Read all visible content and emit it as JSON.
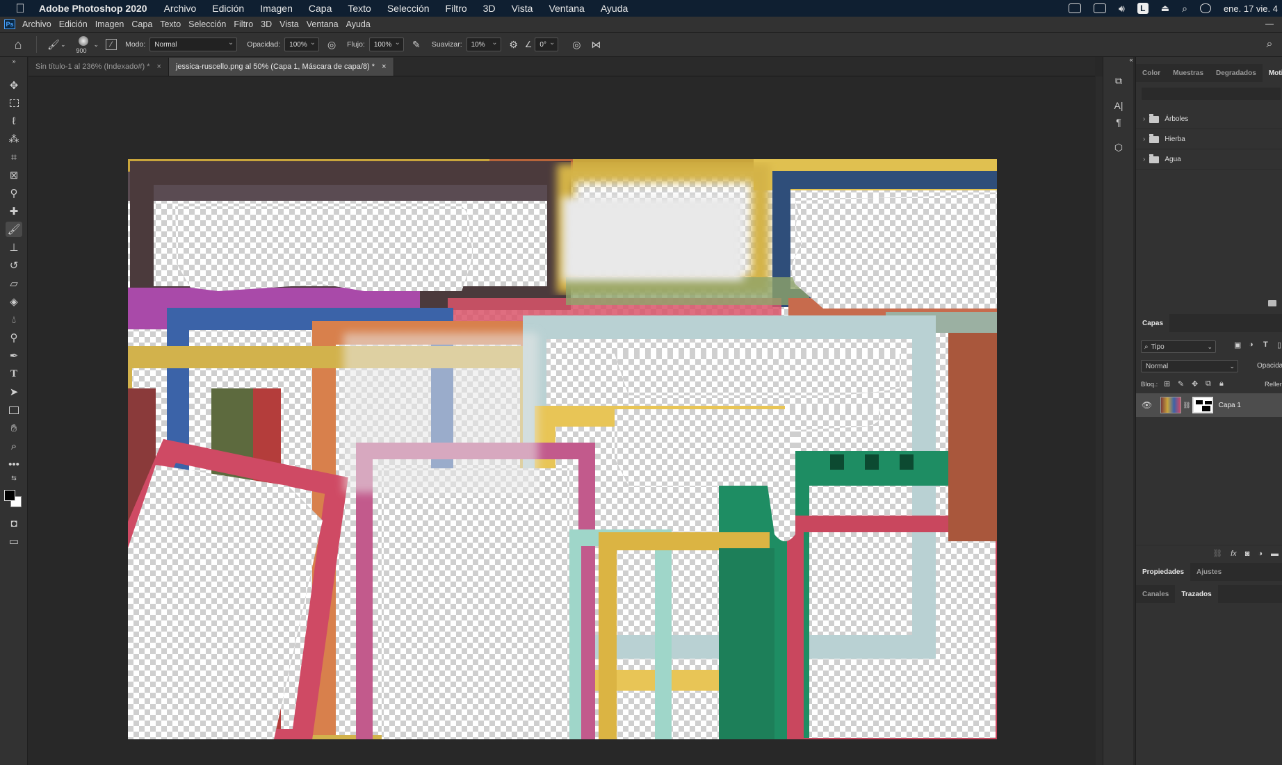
{
  "mac_menu": {
    "app_name": "Adobe Photoshop 2020",
    "items": [
      "Archivo",
      "Edición",
      "Imagen",
      "Capa",
      "Texto",
      "Selección",
      "Filtro",
      "3D",
      "Vista",
      "Ventana",
      "Ayuda"
    ],
    "clock": "ene. 17 vie. 4",
    "status_icons": [
      "creative-cloud-icon",
      "display-icon",
      "volume-icon",
      "user-l-icon",
      "eject-icon",
      "search-icon",
      "control-center-icon"
    ],
    "user_badge": "L"
  },
  "ps_menu": {
    "logo": "Ps",
    "items": [
      "Archivo",
      "Edición",
      "Imagen",
      "Capa",
      "Texto",
      "Selección",
      "Filtro",
      "3D",
      "Vista",
      "Ventana",
      "Ayuda"
    ]
  },
  "options_bar": {
    "brush_size": "900",
    "mode_label": "Modo:",
    "mode_value": "Normal",
    "opacity_label": "Opacidad:",
    "opacity_value": "100%",
    "flow_label": "Flujo:",
    "flow_value": "100%",
    "smooth_label": "Suavizar:",
    "smooth_value": "10%",
    "angle_value": "0°"
  },
  "tabs": [
    {
      "label": "Sin título-1 al 236% (Indexado#) *",
      "active": false
    },
    {
      "label": "jessica-ruscello.png al 50% (Capa 1, Máscara de capa/8) *",
      "active": true
    }
  ],
  "top_panel": {
    "tabs": [
      "Color",
      "Muestras",
      "Degradados",
      "Moti"
    ],
    "active_tab": "Moti",
    "groups": [
      "Árboles",
      "Hierba",
      "Agua"
    ]
  },
  "layers_panel": {
    "title": "Capas",
    "filter_label": "Tipo",
    "blend_mode": "Normal",
    "opacity_label": "Opacida",
    "lock_label": "Bloq.:",
    "fill_label": "Rellen",
    "layers": [
      {
        "name": "Capa 1",
        "visible": true
      }
    ]
  },
  "bottom_tabs": {
    "row1": [
      "Propiedades",
      "Ajustes"
    ],
    "row1_active": "Propiedades",
    "row2": [
      "Canales",
      "Trazados"
    ],
    "row2_active": "Trazados"
  },
  "colors": {
    "accent_blue": "#4aa3ff",
    "menubar": "#0f1f31",
    "panel_bg": "#323232",
    "canvas_bg": "#282828"
  }
}
